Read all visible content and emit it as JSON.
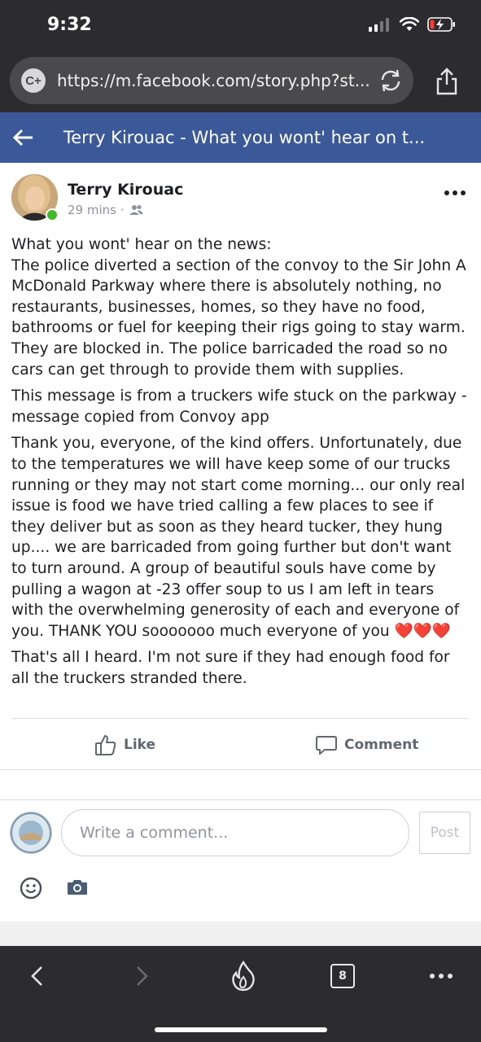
{
  "status_bar": {
    "time": "9:32"
  },
  "browser": {
    "url": "https://m.facebook.com/story.php?st...",
    "site_icon_label": "C+",
    "reload_icon": "reload-icon",
    "share_icon": "share-icon"
  },
  "fb_header": {
    "title": "Terry Kirouac - What you wont' hear on t..."
  },
  "post": {
    "author": "Terry Kirouac",
    "time": "29 mins ·",
    "audience_icon": "friends-icon",
    "paragraphs": [
      "What you wont' hear on the news:\nThe police diverted a section of the convoy to the Sir John A McDonald Parkway where there is absolutely nothing, no restaurants, businesses, homes, so they have no food, bathrooms or fuel for keeping their rigs going to stay warm. They are blocked in. The police barricaded the road so no cars can get through to provide them with supplies.",
      "This message is from a truckers wife stuck on the parkway - message copied from Convoy app",
      "Thank you, everyone, of the kind offers. Unfortunately, due to the temperatures we will have keep some of our trucks running or they may not start come morning... our only real issue is food we have tried calling a few places to see if they deliver but as soon as they heard tucker, they hung up.... we are barricaded from going further but don't want to turn around. A group of beautiful souls have come by pulling a wagon at -23 offer soup to us I am left in tears with the overwhelming generosity of each and everyone of you. THANK YOU sooooooo much everyone of you ❤️❤️❤️",
      "That's all I heard. I'm not sure if they had enough food for all the truckers stranded there."
    ]
  },
  "actions": {
    "like": "Like",
    "comment": "Comment"
  },
  "composer": {
    "placeholder": "Write a comment...",
    "post_label": "Post"
  },
  "bottom_bar": {
    "tabs_count": "8"
  },
  "colors": {
    "fb_blue": "#3b5998",
    "chrome_dark": "#2c2c2e",
    "online": "#42b72a"
  }
}
